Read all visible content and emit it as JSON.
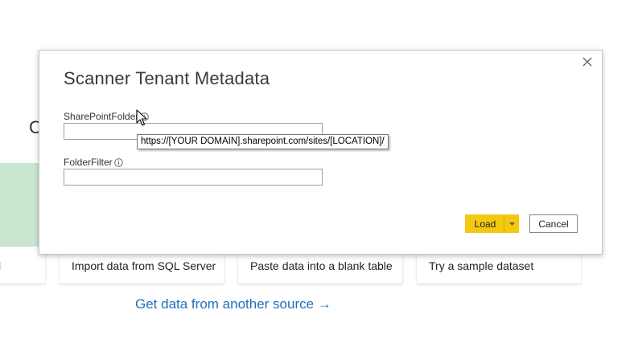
{
  "background": {
    "heading_fragment": "C",
    "tiles": [
      {
        "label": "l"
      },
      {
        "label": "Import data from SQL Server"
      },
      {
        "label": "Paste data into a blank table"
      },
      {
        "label": "Try a sample dataset"
      }
    ],
    "get_data_link": "Get data from another source →"
  },
  "dialog": {
    "title": "Scanner Tenant Metadata",
    "fields": [
      {
        "label": "SharePointFolder",
        "value": "",
        "tooltip": "https://[YOUR DOMAIN].sharepoint.com/sites/[LOCATION]/"
      },
      {
        "label": "FolderFilter",
        "value": ""
      }
    ],
    "load_label": "Load",
    "cancel_label": "Cancel"
  },
  "icons": {
    "close": "close-icon",
    "info": "info-icon",
    "dropdown": "chevron-down-icon",
    "cursor": "mouse-pointer-icon"
  },
  "colors": {
    "load_button": "#f2c811",
    "link": "#1f6fbf",
    "green_panel": "#c8e6d0"
  }
}
